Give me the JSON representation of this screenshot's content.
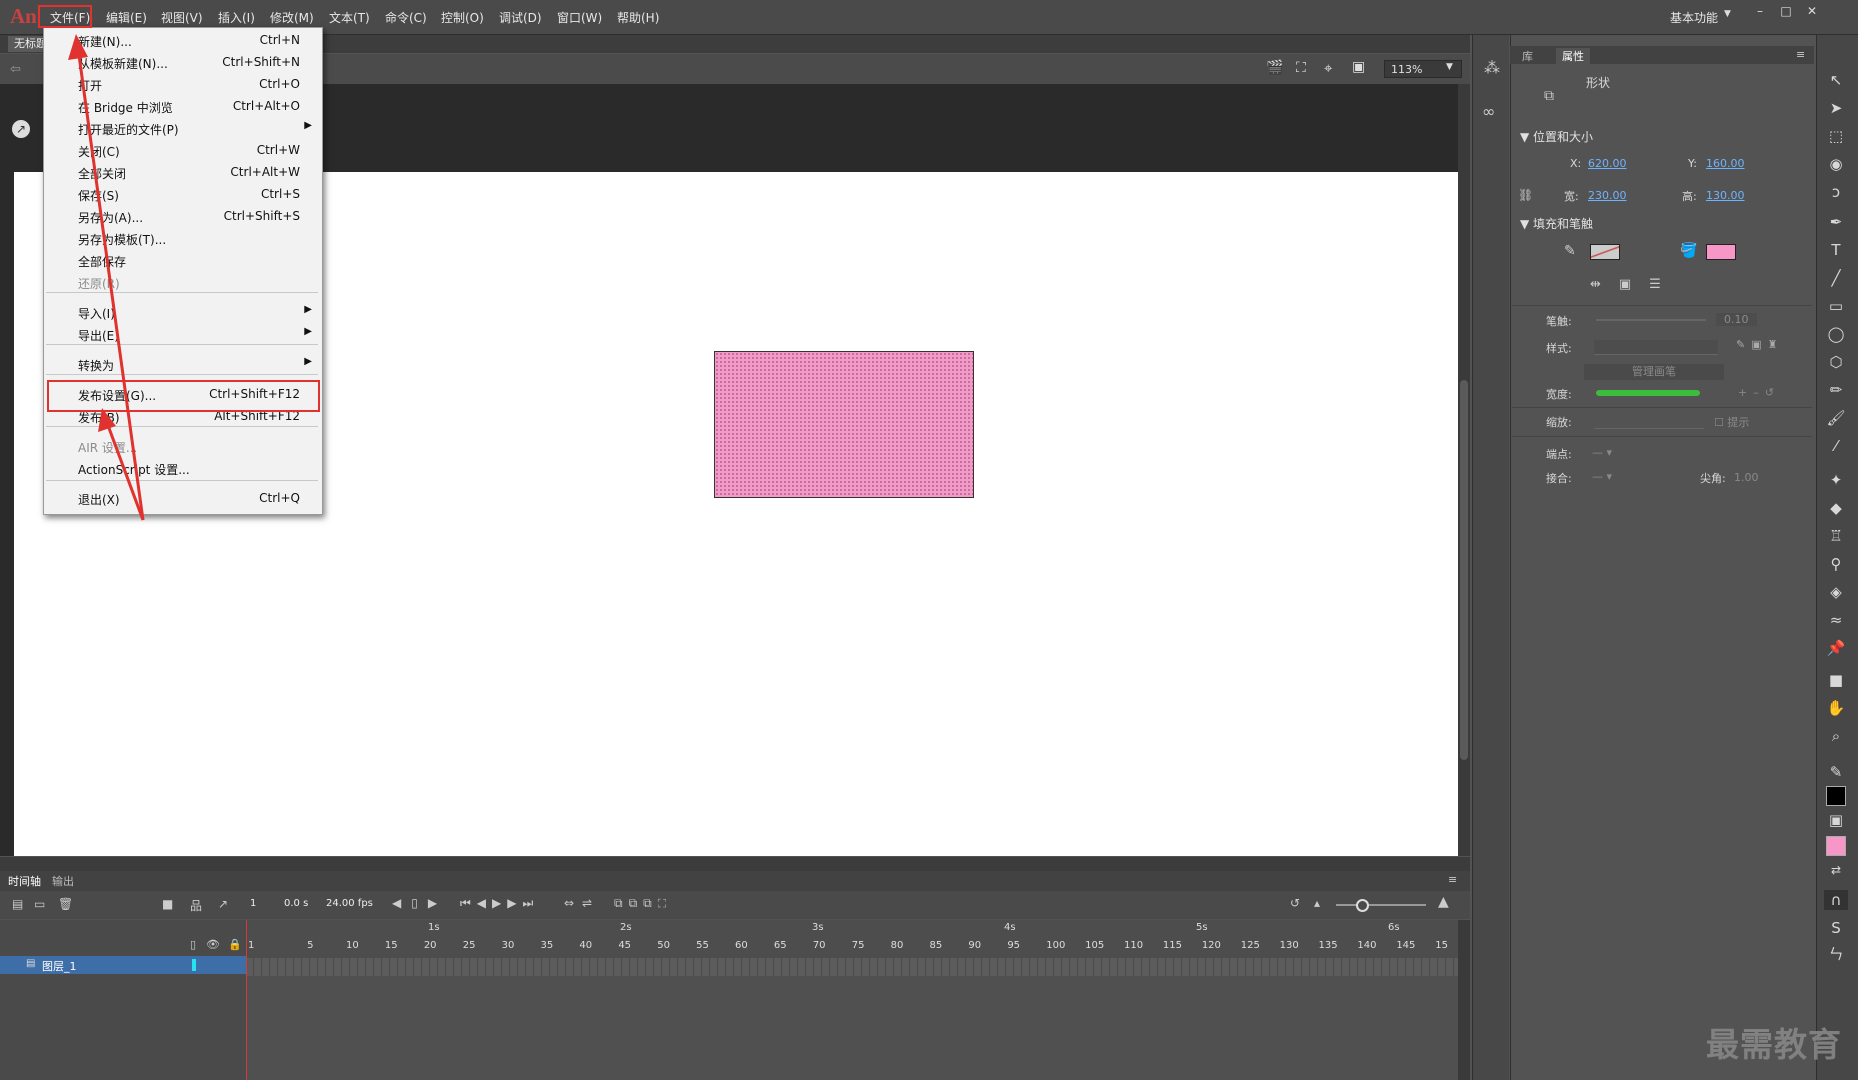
{
  "app": {
    "logo": "An"
  },
  "menubar": {
    "items": [
      "文件(F)",
      "编辑(E)",
      "视图(V)",
      "插入(I)",
      "修改(M)",
      "文本(T)",
      "命令(C)",
      "控制(O)",
      "调试(D)",
      "窗口(W)",
      "帮助(H)"
    ],
    "workspace": "基本功能"
  },
  "document": {
    "tab": "无标题",
    "zoom": "113%"
  },
  "file_menu": {
    "items": [
      {
        "label": "新建(N)...",
        "shortcut": "Ctrl+N"
      },
      {
        "label": "从模板新建(N)...",
        "shortcut": "Ctrl+Shift+N"
      },
      {
        "label": "打开",
        "shortcut": "Ctrl+O"
      },
      {
        "label": "在 Bridge 中浏览",
        "shortcut": "Ctrl+Alt+O"
      },
      {
        "label": "打开最近的文件(P)",
        "shortcut": ""
      },
      {
        "label": "关闭(C)",
        "shortcut": "Ctrl+W"
      },
      {
        "label": "全部关闭",
        "shortcut": "Ctrl+Alt+W"
      },
      {
        "label": "保存(S)",
        "shortcut": "Ctrl+S"
      },
      {
        "label": "另存为(A)...",
        "shortcut": "Ctrl+Shift+S"
      },
      {
        "label": "另存为模板(T)...",
        "shortcut": ""
      },
      {
        "label": "全部保存",
        "shortcut": ""
      },
      {
        "label": "还原(R)",
        "shortcut": ""
      },
      {
        "label": "导入(I)",
        "shortcut": ""
      },
      {
        "label": "导出(E)",
        "shortcut": ""
      },
      {
        "label": "转换为",
        "shortcut": ""
      },
      {
        "label": "发布设置(G)...",
        "shortcut": "Ctrl+Shift+F12"
      },
      {
        "label": "发布(B)",
        "shortcut": "Alt+Shift+F12"
      },
      {
        "label": "AIR 设置...",
        "shortcut": ""
      },
      {
        "label": "ActionScript 设置...",
        "shortcut": ""
      },
      {
        "label": "退出(X)",
        "shortcut": "Ctrl+Q"
      }
    ]
  },
  "timeline": {
    "tabs": [
      "时间轴",
      "输出"
    ],
    "frame": "1",
    "time": "0.0 s",
    "fps": "24.00 fps",
    "seconds": [
      "1s",
      "2s",
      "3s",
      "4s",
      "5s",
      "6s"
    ],
    "frame_ticks": [
      "1",
      "5",
      "10",
      "15",
      "20",
      "25",
      "30",
      "35",
      "40",
      "45",
      "50",
      "55",
      "60",
      "65",
      "70",
      "75",
      "80",
      "85",
      "90",
      "95",
      "100",
      "105",
      "110",
      "115",
      "120",
      "125",
      "130",
      "135",
      "140",
      "145",
      "15"
    ],
    "layer_name": "图层_1"
  },
  "properties": {
    "tabs": [
      "库",
      "属性"
    ],
    "object_type": "形状",
    "position_size": {
      "title": "位置和大小",
      "x_label": "X:",
      "x": "620.00",
      "y_label": "Y:",
      "y": "160.00",
      "w_label": "宽:",
      "w": "230.00",
      "h_label": "高:",
      "h": "130.00"
    },
    "fill_stroke": {
      "title": "填充和笔触",
      "fill_color": "#f797c8",
      "stroke_label": "笔触:",
      "stroke_value": "0.10",
      "style_label": "样式:",
      "manage_brush": "管理画笔",
      "width_label": "宽度:",
      "scale_label": "缩放:",
      "hint_label": "提示",
      "cap_label": "端点:",
      "join_label": "接合:",
      "miter_label": "尖角:",
      "miter_value": "1.00"
    }
  },
  "watermark": "最需教育",
  "colors": {
    "accent_red": "#e0322f",
    "layer_blue": "#3e6ea8",
    "fill_pink": "#f797c8"
  }
}
